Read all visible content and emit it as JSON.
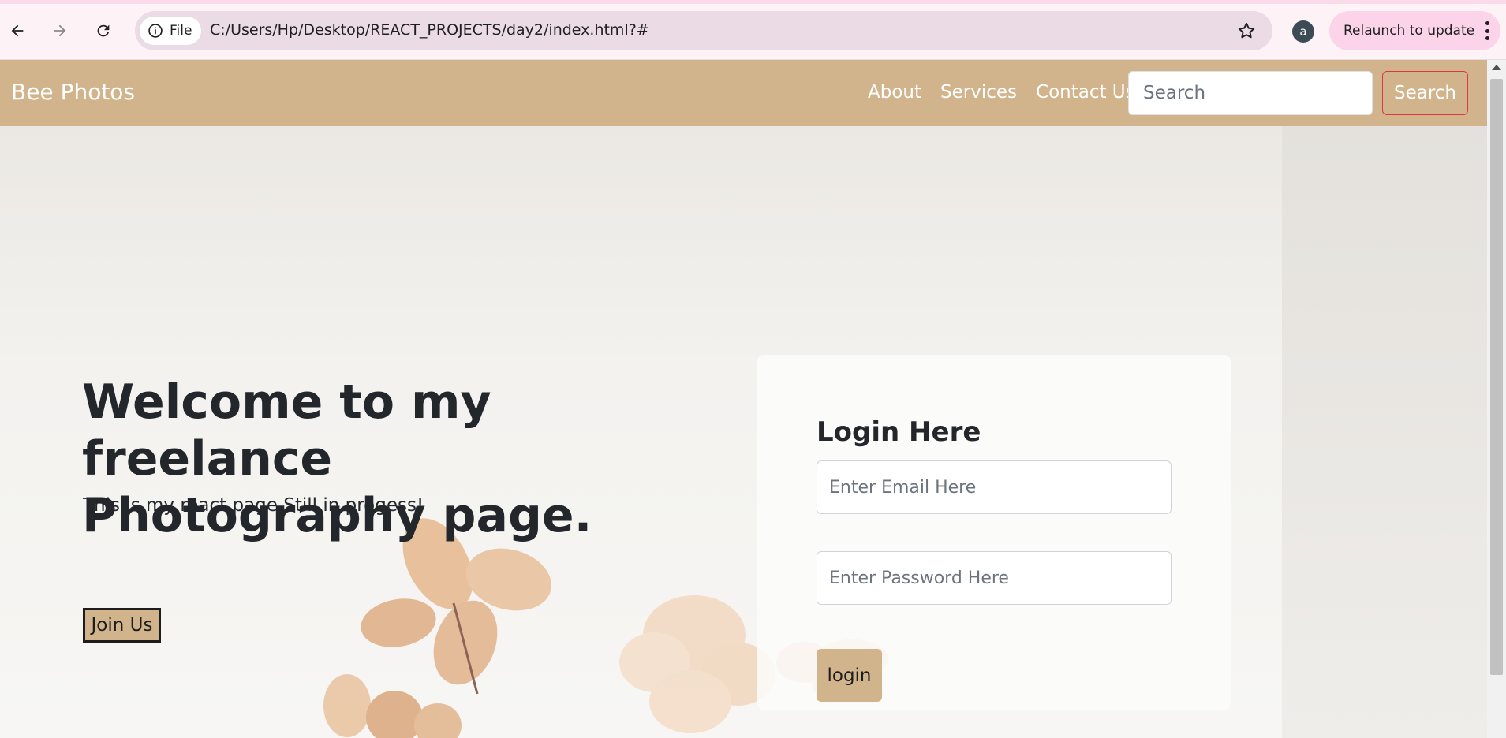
{
  "browser": {
    "site_chip_label": "File",
    "url": "C:/Users/Hp/Desktop/REACT_PROJECTS/day2/index.html?#",
    "profile_initial": "a",
    "relaunch_label": "Relaunch to update",
    "icons": [
      "back-icon",
      "forward-icon",
      "reload-icon",
      "info-icon",
      "star-icon",
      "more-vert-icon"
    ]
  },
  "navbar": {
    "brand": "Bee Photos",
    "links": [
      {
        "label": "About"
      },
      {
        "label": "Services"
      },
      {
        "label": "Contact Us"
      }
    ],
    "search_placeholder": "Search",
    "search_button": "Search"
  },
  "hero": {
    "title": "Welcome to my freelance Photography page.",
    "subtitle": "This is my react page.Still in progess!",
    "join_button": "Join Us"
  },
  "login": {
    "title": "Login Here",
    "email_placeholder": "Enter Email Here",
    "password_placeholder": "Enter Password Here",
    "button": "login"
  },
  "colors": {
    "navbar_bg": "#d2b48c",
    "chrome_bg": "#fdf3f7",
    "omnibox_bg": "#eadbe4",
    "relaunch_bg": "#fbd4ea",
    "search_button_border": "#dc3545",
    "text_dark": "#23262b"
  }
}
